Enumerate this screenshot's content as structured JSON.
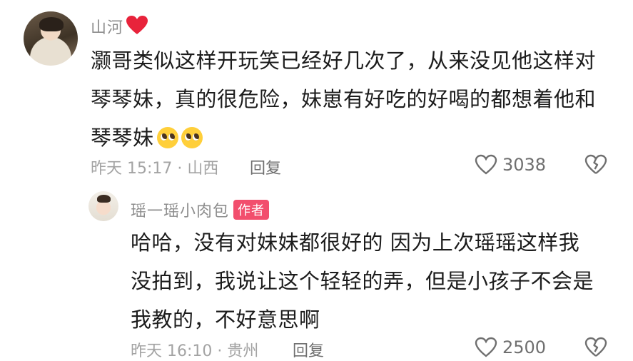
{
  "comment": {
    "username": "山河",
    "text_lines": [
      "灏哥类似这样开玩笑已经好几次了，从来没见他这样对",
      "琴琴妹，真的很危险，妹崽有好吃的好喝的都想着他和",
      "琴琴妹"
    ],
    "meta": "昨天 15:17 · 山西",
    "reply_label": "回复",
    "likes": "3038"
  },
  "reply": {
    "username": "瑶一瑶小肉包",
    "author_tag": "作者",
    "text_lines": [
      "哈哈，没有对妹妹都很好的 因为上次瑶瑶这样我",
      "没拍到，我说让这个轻轻的弄，但是小孩子不会是",
      "我教的，不好意思啊"
    ],
    "meta": "昨天 16:10 · 贵州",
    "reply_label": "回复",
    "likes": "2500"
  },
  "icons": {
    "heart_badge": "red-heart-icon",
    "like": "heart-outline-icon",
    "dislike": "broken-heart-icon",
    "emoji": "pleading-face-emoji"
  },
  "colors": {
    "author_tag": "#f24e6d",
    "heart_badge": "#e8233b",
    "meta_text": "#a3a3a3"
  }
}
